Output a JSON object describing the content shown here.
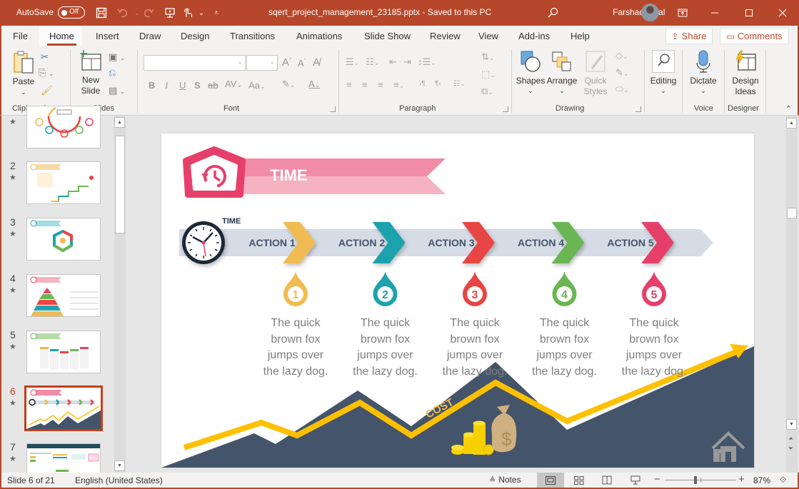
{
  "titlebar": {
    "autosave_label": "AutoSave",
    "autosave_state": "Off",
    "document_title": "sqert_project_management_23185.pptx  -  Saved to this PC",
    "user_name": "Farshad Iqbal",
    "icons": [
      "save-icon",
      "undo-icon",
      "redo-icon",
      "present-icon",
      "touch-mode-icon",
      "customize-qat-icon",
      "search-icon",
      "ribbon-display-icon",
      "minimize-icon",
      "maximize-icon",
      "close-icon"
    ]
  },
  "ribbon_tabs": [
    "File",
    "Home",
    "Insert",
    "Draw",
    "Design",
    "Transitions",
    "Animations",
    "Slide Show",
    "Review",
    "View",
    "Add-ins",
    "Help"
  ],
  "active_tab": "Home",
  "share_label": "Share",
  "comments_label": "Comments",
  "ribbon": {
    "clipboard": {
      "label": "Clipboard",
      "paste": "Paste"
    },
    "slides": {
      "label": "Slides",
      "new_slide_1": "New",
      "new_slide_2": "Slide"
    },
    "font": {
      "label": "Font",
      "font_name": "",
      "font_size": "",
      "bold": "B",
      "italic": "I",
      "underline": "U",
      "shadow": "S",
      "strike": "ab",
      "spacing": "AV",
      "case": "Aa",
      "grow": "A",
      "shrink": "A"
    },
    "paragraph": {
      "label": "Paragraph"
    },
    "drawing": {
      "label": "Drawing",
      "shapes": "Shapes",
      "arrange": "Arrange",
      "quick_styles_1": "Quick",
      "quick_styles_2": "Styles"
    },
    "editing": {
      "label": "Editing"
    },
    "voice": {
      "label": "Voice",
      "dictate": "Dictate"
    },
    "designer": {
      "label": "Designer",
      "design_ideas_1": "Design",
      "design_ideas_2": "Ideas"
    }
  },
  "slide_panel": {
    "thumbnails": [
      {
        "number": "",
        "title": "PROJECT"
      },
      {
        "number": "2",
        "title": "SCOPE"
      },
      {
        "number": "3",
        "title": "QUALITY"
      },
      {
        "number": "4",
        "title": "RISKS"
      },
      {
        "number": "5",
        "title": "RISK"
      },
      {
        "number": "6",
        "title": "TIME",
        "selected": true
      },
      {
        "number": "7",
        "title": "PROJECT MANAGEMENT DASHBOARD"
      }
    ],
    "star": "★"
  },
  "slide": {
    "header_title": "TIME",
    "timeline_label": "TIME",
    "colors": {
      "yellow": "#f0bb52",
      "teal": "#1fa2ad",
      "red": "#e84545",
      "green": "#6ab654",
      "pink": "#e6406a",
      "navy": "#44546a",
      "arrow_band": "#d5dce5",
      "cost_line": "#ffc000",
      "ribbon_dark": "#f08ca5",
      "ribbon_light": "#f5b3c2"
    },
    "actions": [
      {
        "label": "ACTION 1",
        "number": "1",
        "color": "#f0bb52",
        "text": [
          "The quick",
          "brown fox",
          "jumps over",
          "the lazy dog."
        ]
      },
      {
        "label": "ACTION 2",
        "number": "2",
        "color": "#1fa2ad",
        "text": [
          "The quick",
          "brown fox",
          "jumps over",
          "the lazy dog."
        ]
      },
      {
        "label": "ACTION 3",
        "number": "3",
        "color": "#e84545",
        "text": [
          "The quick",
          "brown fox",
          "jumps over",
          "the lazy dog."
        ]
      },
      {
        "label": "ACTION 4",
        "number": "4",
        "color": "#6ab654",
        "text": [
          "The quick",
          "brown fox",
          "jumps over",
          "the lazy dog."
        ]
      },
      {
        "label": "ACTION 5",
        "number": "5",
        "color": "#e6406a",
        "text": [
          "The quick",
          "brown fox",
          "jumps over",
          "the lazy dog."
        ]
      }
    ],
    "cost_label": "COST",
    "money_symbol": "$"
  },
  "statusbar": {
    "slide_info": "Slide 6 of 21",
    "language": "English (United States)",
    "notes_label": "Notes",
    "zoom_level": "87%",
    "zoom_percent": 87
  }
}
